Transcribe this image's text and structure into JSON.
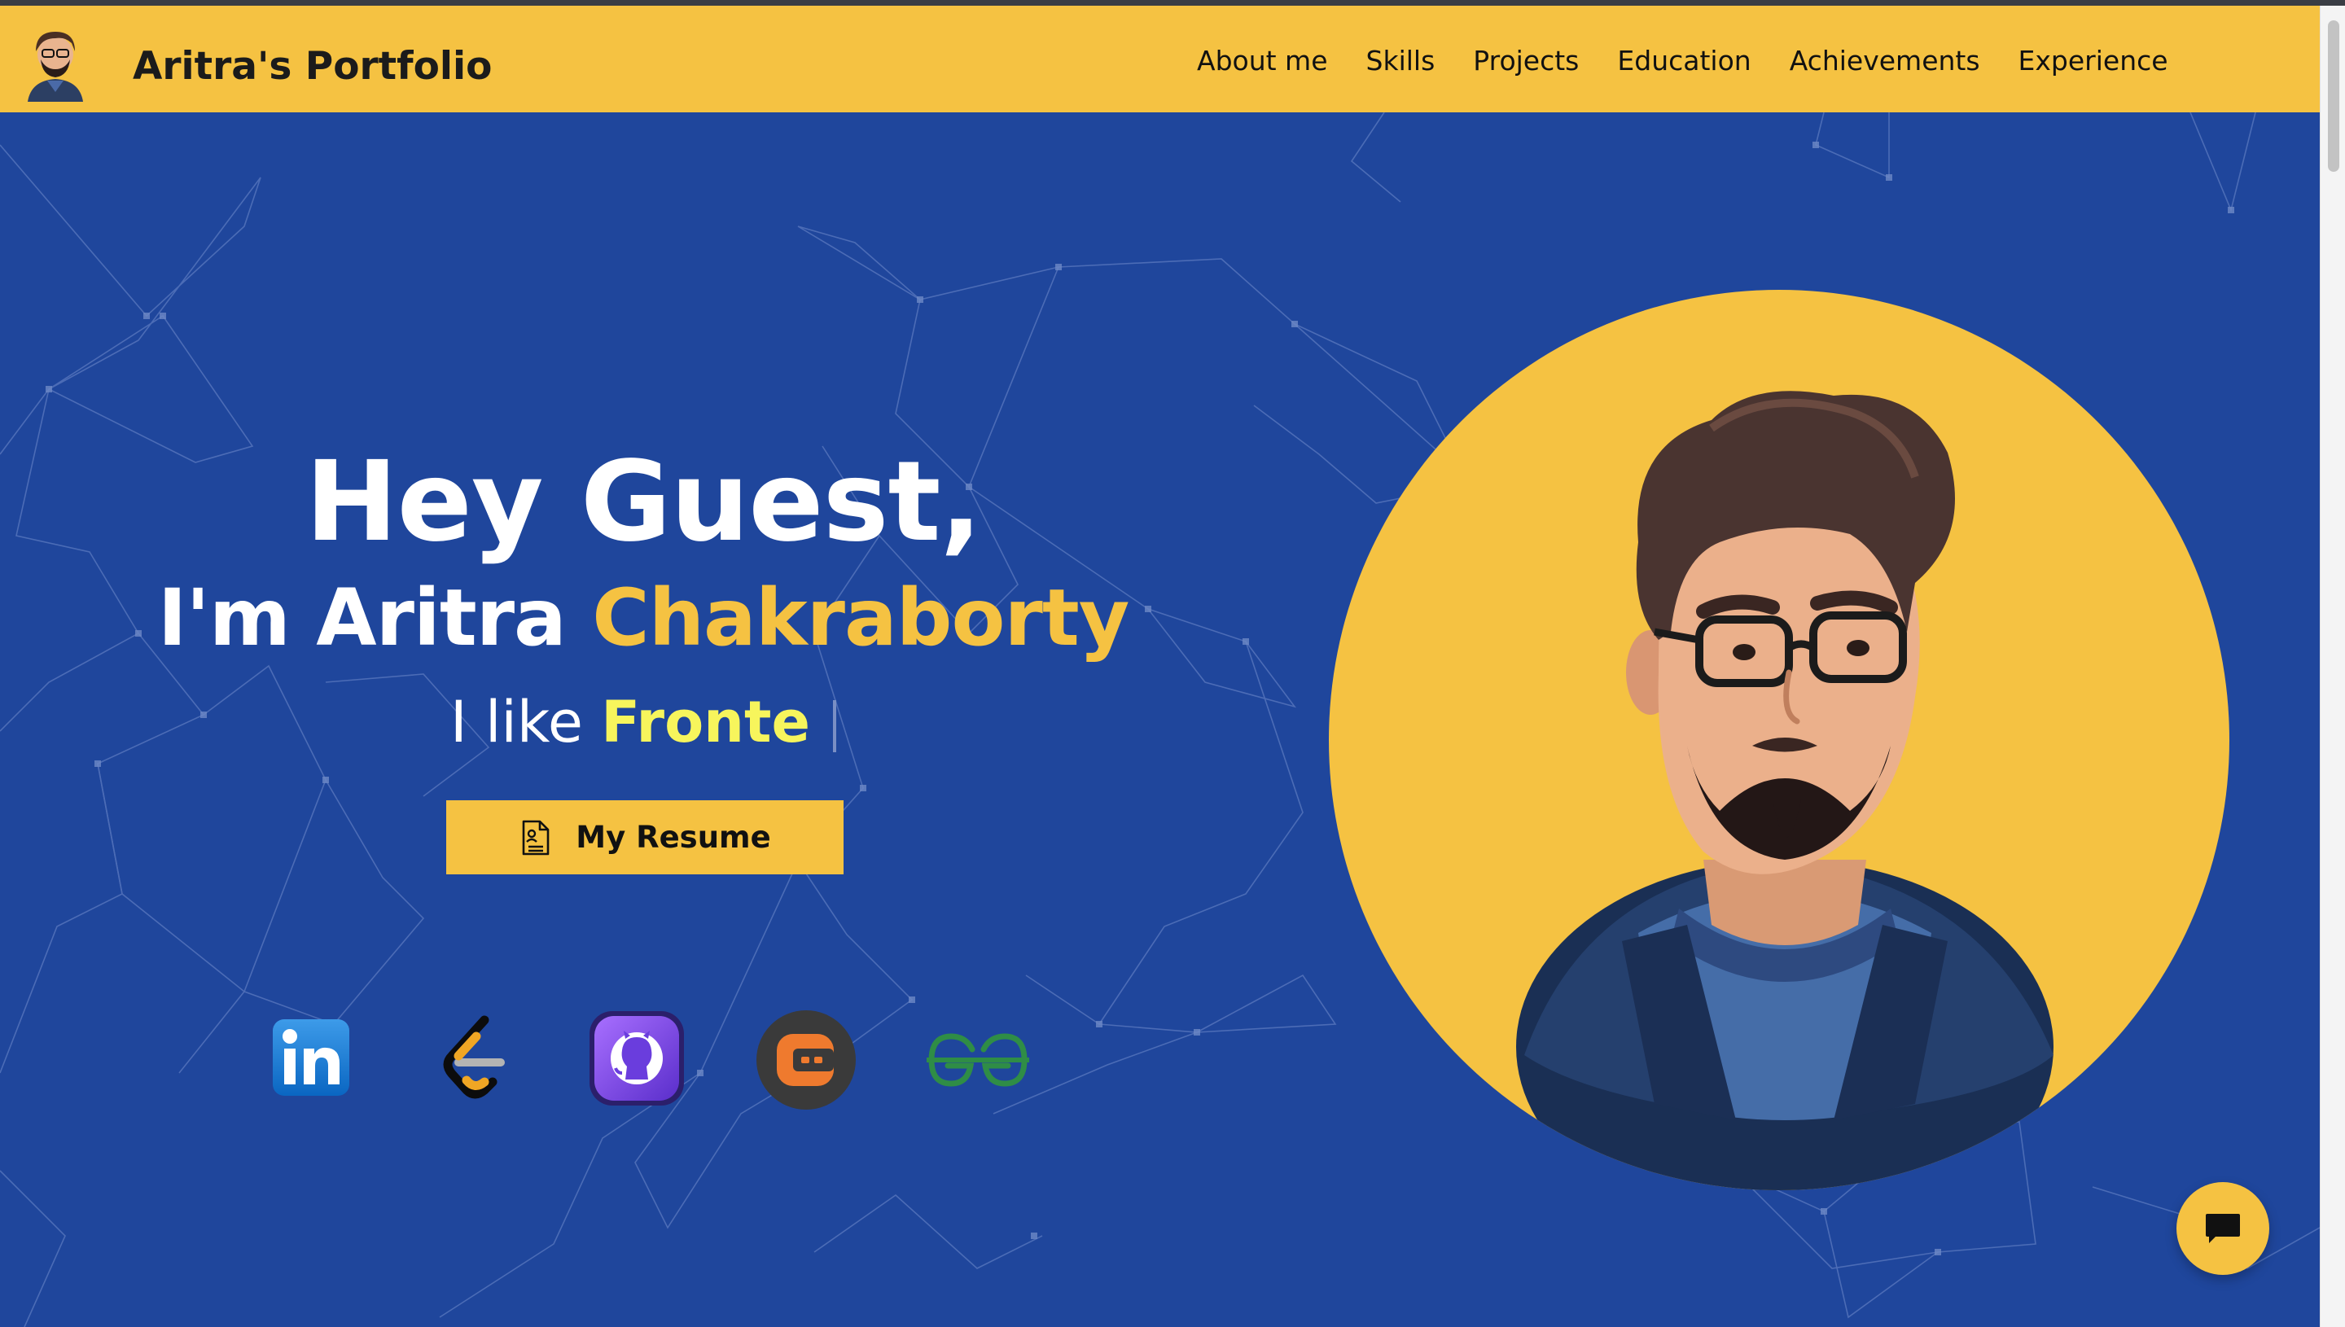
{
  "brand": {
    "title": "Aritra's Portfolio",
    "avatar_icon": "avatar-icon"
  },
  "nav": {
    "items": [
      {
        "label": "About me"
      },
      {
        "label": "Skills"
      },
      {
        "label": "Projects"
      },
      {
        "label": "Education"
      },
      {
        "label": "Achievements"
      },
      {
        "label": "Experience"
      }
    ]
  },
  "hero": {
    "greeting": "Hey Guest,",
    "name_prefix": "I'm Aritra ",
    "name_highlight": "Chakraborty",
    "typed_prefix": "I like ",
    "typed_word": "Fronte",
    "resume_label": "My Resume",
    "resume_icon": "document-icon"
  },
  "socials": [
    {
      "name": "linkedin",
      "icon": "linkedin-icon"
    },
    {
      "name": "leetcode",
      "icon": "leetcode-icon"
    },
    {
      "name": "github",
      "icon": "github-icon"
    },
    {
      "name": "codechef",
      "icon": "codechef-icon"
    },
    {
      "name": "geeksforgeeks",
      "icon": "geeksforgeeks-icon"
    }
  ],
  "portrait": {
    "icon": "avatar-illustration"
  },
  "chat": {
    "icon": "chat-icon"
  },
  "colors": {
    "accent": "#f5c242",
    "background": "#1f469c",
    "typed_highlight": "#f7f55c",
    "text_dark": "#111111",
    "text_light": "#ffffff"
  }
}
